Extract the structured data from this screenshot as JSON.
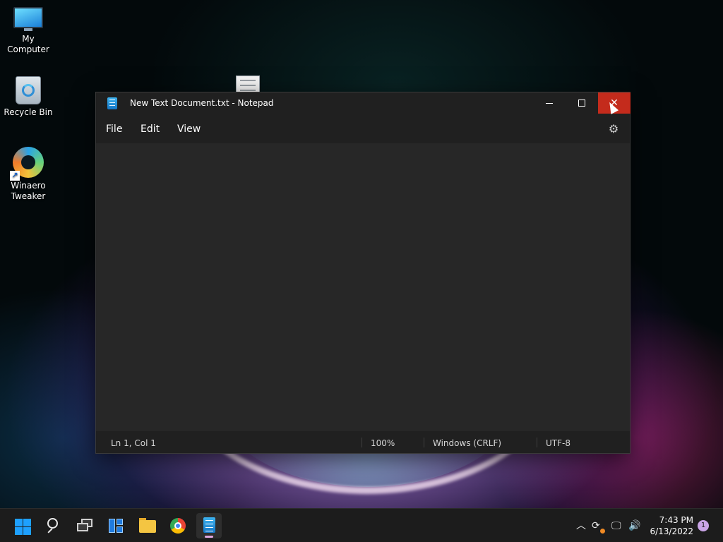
{
  "desktop": {
    "icons": [
      {
        "label": "My Computer",
        "icon": "computer-monitor-icon"
      },
      {
        "label": "Recycle Bin",
        "icon": "recycle-bin-icon"
      },
      {
        "label": "Winaero Tweaker",
        "icon": "winaero-tweaker-icon"
      }
    ]
  },
  "notepad": {
    "title": "New Text Document.txt - Notepad",
    "menu": {
      "file": "File",
      "edit": "Edit",
      "view": "View"
    },
    "editor_text": "",
    "status": {
      "position": "Ln 1, Col 1",
      "zoom": "100%",
      "line_ending": "Windows (CRLF)",
      "encoding": "UTF-8"
    },
    "colors": {
      "close_hover": "#c42b1c",
      "background": "#202020",
      "editor": "#272727"
    }
  },
  "taskbar": {
    "apps": [
      "start-icon",
      "search-icon",
      "task-view-icon",
      "widgets-icon",
      "file-explorer-icon",
      "chrome-icon",
      "notepad-icon"
    ],
    "active_app": "notepad-icon",
    "clock": {
      "time": "7:43 PM",
      "date": "6/13/2022"
    },
    "notification_count": "1"
  }
}
